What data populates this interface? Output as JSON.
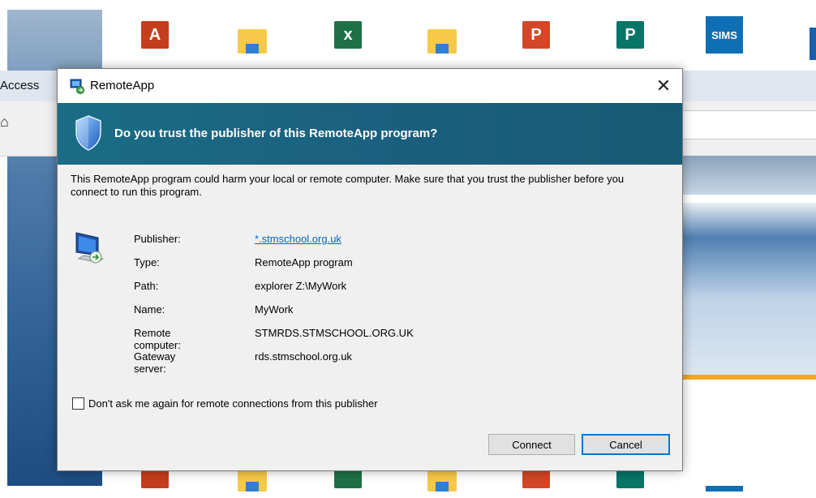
{
  "background": {
    "browser_tab_label": "Access",
    "taskbar_icons": [
      {
        "name": "access-icon",
        "label": "A",
        "color": "#c43e1c"
      },
      {
        "name": "file-explorer-icon",
        "label": "",
        "color": "#f7c948"
      },
      {
        "name": "excel-icon",
        "label": "x",
        "color": "#1e7145"
      },
      {
        "name": "file-explorer-icon-2",
        "label": "",
        "color": "#f7c948"
      },
      {
        "name": "powerpoint-icon",
        "label": "P",
        "color": "#d24726"
      },
      {
        "name": "publisher-icon",
        "label": "P",
        "color": "#077568"
      },
      {
        "name": "sims-icon",
        "label": "SIMS",
        "color": "#0f6fb4"
      }
    ]
  },
  "dialog": {
    "title": "RemoteApp",
    "close_label": "✕",
    "header_text": "Do you trust the publisher of this RemoteApp program?",
    "warning_text": "This RemoteApp program could harm your local or remote computer. Make sure that you trust the publisher before you connect to run this program.",
    "details": [
      {
        "label": "Publisher:",
        "value": "*.stmschool.org.uk",
        "link": true
      },
      {
        "label": "Type:",
        "value": "RemoteApp program",
        "link": false
      },
      {
        "label": "Path:",
        "value": "explorer Z:\\MyWork",
        "link": false
      },
      {
        "label": "Name:",
        "value": "MyWork",
        "link": false
      },
      {
        "label": "Remote computer:",
        "value": "STMRDS.STMSCHOOL.ORG.UK",
        "link": false
      },
      {
        "label": "Gateway server:",
        "value": "rds.stmschool.org.uk",
        "link": false
      }
    ],
    "checkbox_label": "Don't ask me again for remote connections from this publisher",
    "checkbox_checked": false,
    "connect_label": "Connect",
    "cancel_label": "Cancel"
  }
}
